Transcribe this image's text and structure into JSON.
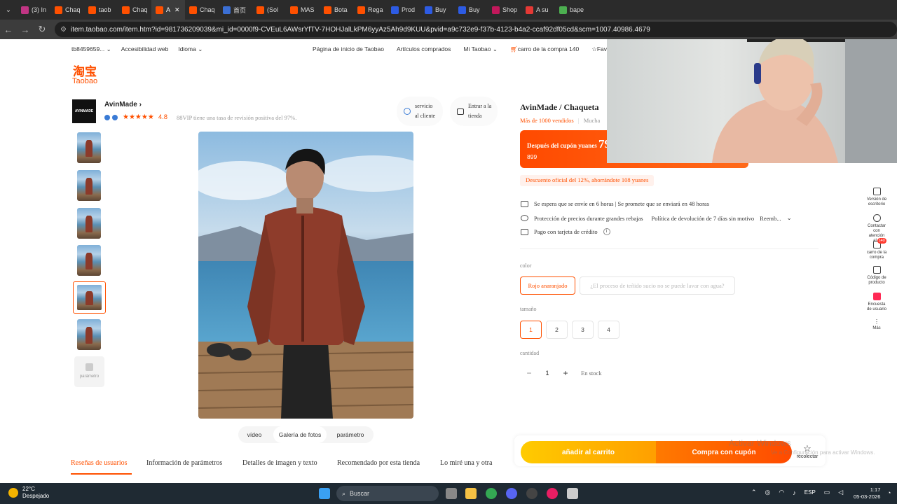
{
  "browser": {
    "tabs": [
      {
        "label": "(3) In",
        "color": "#c13584"
      },
      {
        "label": "Chaq",
        "color": "#ff5000"
      },
      {
        "label": "taob",
        "color": "#ff5000"
      },
      {
        "label": "Chaq",
        "color": "#ff5000"
      },
      {
        "label": "A",
        "color": "#ff5000",
        "active": true
      },
      {
        "label": "Chaq",
        "color": "#ff5000"
      },
      {
        "label": "首页",
        "color": "#3b6fd4"
      },
      {
        "label": "(Sol",
        "color": "#ff5000"
      },
      {
        "label": "MAS",
        "color": "#ff5000"
      },
      {
        "label": "Bota",
        "color": "#ff5000"
      },
      {
        "label": "Rega",
        "color": "#ff5000"
      },
      {
        "label": "Prod",
        "color": "#2d5be3"
      },
      {
        "label": "Buy",
        "color": "#2d5be3"
      },
      {
        "label": "Buy",
        "color": "#2d5be3"
      },
      {
        "label": "Shop",
        "color": "#c2185b"
      },
      {
        "label": "A su",
        "color": "#e53935"
      },
      {
        "label": "bape",
        "color": "#4caf50"
      }
    ],
    "close_glyph": "✕",
    "url": "item.taobao.com/item.htm?id=981736209039&mi_id=0000f9-CVEuL6AWsrYfTV-7HOHJalLkPM6yyAz5Ah9d9KUU&pvid=a9c732e9-f37b-4123-b4a2-ccaf92df05cd&scm=1007.40986.4679"
  },
  "topnav": {
    "user": "tb8459659...",
    "accessibility": "Accesibilidad web",
    "language": "Idioma",
    "home": "Página de inicio de Taobao",
    "purchased": "Artículos comprados",
    "my_taobao": "Mi Taobao",
    "cart": "carro de la compra 140",
    "favorites": "Favoritos"
  },
  "logo": {
    "chinese": "淘宝",
    "latin": "Taobao"
  },
  "shop": {
    "logo_text": "AVINMADE",
    "name": "AvinMade",
    "rating": "4.8",
    "vip_text": "88VIP tiene una tasa de revisión positiva del 97%.",
    "service_label": "servicio al cliente",
    "enter_store": "Entrar a la tienda"
  },
  "gallery": {
    "param_thumb": "parámetro",
    "tabs": [
      "vídeo",
      "Galería de fotos",
      "parámetro"
    ]
  },
  "product": {
    "title": "AvinMade / Chaqueta",
    "sold": "Más de 1000 vendidos",
    "sold_extra": "Mucha",
    "after_coupon": "Después del cupón",
    "yuan_label": "yuanes",
    "price": "79",
    "orig_price": "899",
    "discount": "Descuento oficial del 12%, ahorrándote 108 yuanes",
    "shipping": "Se espera que se envíe en 6 horas | Se promete que se enviará en 48 horas",
    "protection": "Protección de precios durante grandes rebajas",
    "returns": "Política de devolución de 7 días sin motivo",
    "refund": "Reemb...",
    "credit": "Pago con tarjeta de crédito",
    "color_label": "color",
    "colors": [
      "Rojo anaranjado",
      "¿El proceso de teñido sucio no se puede lavar con agua?"
    ],
    "size_label": "tamaño",
    "sizes": [
      "1",
      "2",
      "3",
      "4"
    ],
    "qty_label": "cantidad",
    "qty": "1",
    "stock": "En stock",
    "add_cart": "añadir al carrito",
    "buy_coupon": "Compra con cupón",
    "collect": "recolectar",
    "watermark1": "Activar Windows",
    "watermark2": "Ve a Configuración para activar Windows."
  },
  "bottom_tabs": [
    "Reseñas de usuarios",
    "Información de parámetros",
    "Detalles de imagen y texto",
    "Recomendado por esta tienda",
    "Lo miré una y otra"
  ],
  "right_sidebar": [
    {
      "label": "Versión de escritorio"
    },
    {
      "label": "Contactar con atención al..."
    },
    {
      "label": "carro de la compra",
      "badge": "140"
    },
    {
      "label": "Código de producto"
    },
    {
      "label": "Encuesta de usuario"
    },
    {
      "label": "Más"
    }
  ],
  "taskbar": {
    "temp": "22°C",
    "weather": "Despejado",
    "search": "Buscar",
    "lang": "ESP",
    "time": "1:17",
    "date": "05-03-2026"
  }
}
